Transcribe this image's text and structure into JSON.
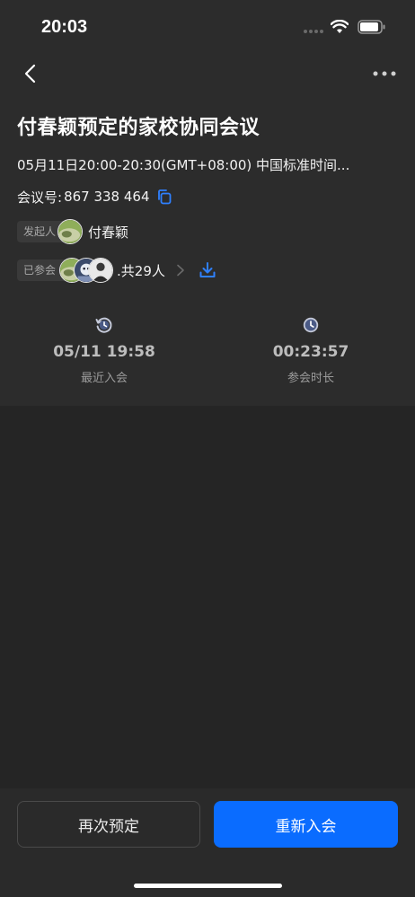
{
  "status_bar": {
    "time": "20:03"
  },
  "meeting": {
    "title": "付春颖预定的家校协同会议",
    "time_range": "05月11日20:00-20:30(GMT+08:00) 中国标准时间...",
    "id_label": "会议号:",
    "id_value": "867 338 464"
  },
  "host": {
    "tag": "发起人",
    "name": "付春颖"
  },
  "participants": {
    "tag": "已参会",
    "count_text": ".共29人"
  },
  "stats": {
    "recent_join": {
      "value": "05/11 19:58",
      "label": "最近入会",
      "icon": "history-clock-icon"
    },
    "duration": {
      "value": "00:23:57",
      "label": "参会时长",
      "icon": "clock-icon"
    }
  },
  "actions": {
    "rebook_label": "再次预定",
    "rejoin_label": "重新入会"
  },
  "colors": {
    "accent": "#0a6cff",
    "panel": "#2c2c2c",
    "background": "#252525"
  }
}
